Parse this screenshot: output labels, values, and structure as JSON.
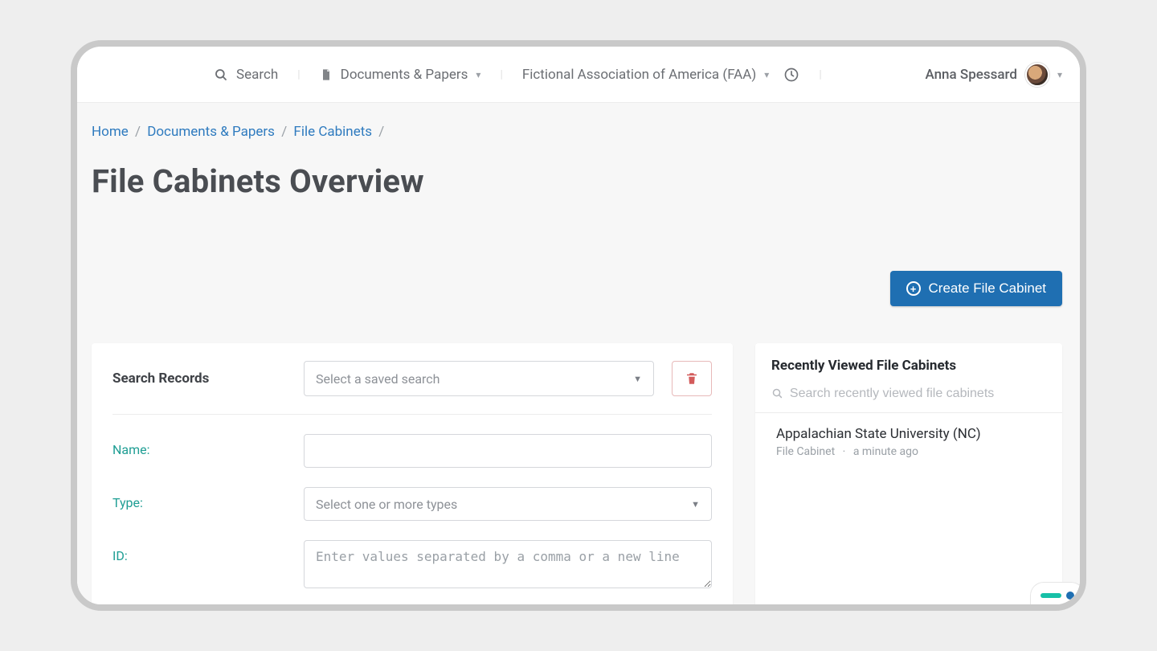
{
  "header": {
    "search_label": "Search",
    "nav_documents_label": "Documents & Papers",
    "org_name": "Fictional Association of America (FAA)",
    "user_name": "Anna Spessard"
  },
  "breadcrumbs": {
    "home": "Home",
    "documents": "Documents & Papers",
    "file_cabinets": "File Cabinets"
  },
  "page": {
    "title": "File Cabinets Overview",
    "create_button": "Create File Cabinet"
  },
  "search_panel": {
    "heading": "Search Records",
    "saved_search_placeholder": "Select a saved search",
    "name_label": "Name:",
    "type_label": "Type:",
    "type_placeholder": "Select one or more types",
    "id_label": "ID:",
    "id_placeholder": "Enter values separated by a comma or a new line"
  },
  "recent_panel": {
    "heading": "Recently Viewed File Cabinets",
    "search_placeholder": "Search recently viewed file cabinets",
    "items": [
      {
        "title": "Appalachian State University (NC)",
        "type": "File Cabinet",
        "when": "a minute ago"
      }
    ]
  },
  "colors": {
    "primary": "#1f6fb2",
    "accentTeal": "#1f9e94",
    "danger": "#d35b5b"
  }
}
